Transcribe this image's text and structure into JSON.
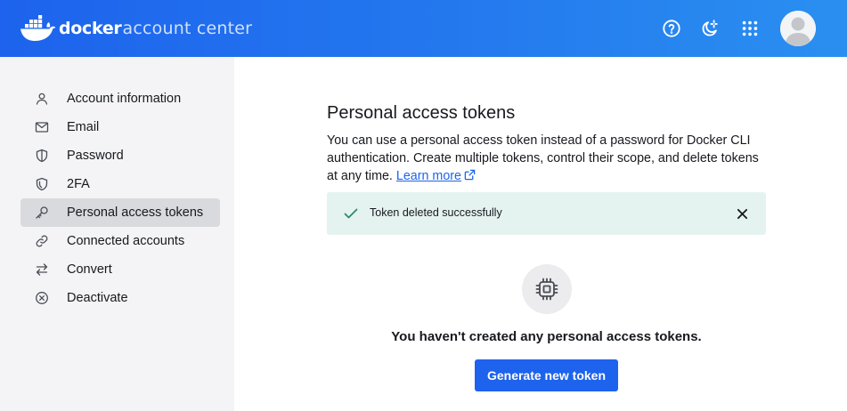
{
  "header": {
    "brand": "docker",
    "product": "account center",
    "icons": [
      "help-icon",
      "theme-icon",
      "apps-grid-icon"
    ],
    "colors": {
      "brand_blue": "#1d63ed",
      "gradient_end": "#2a8ff0"
    }
  },
  "sidebar": {
    "items": [
      {
        "label": "Account information",
        "icon": "user-icon",
        "active": false
      },
      {
        "label": "Email",
        "icon": "mail-icon",
        "active": false
      },
      {
        "label": "Password",
        "icon": "shield-icon",
        "active": false
      },
      {
        "label": "2FA",
        "icon": "shield-check-icon",
        "active": false
      },
      {
        "label": "Personal access tokens",
        "icon": "key-icon",
        "active": true
      },
      {
        "label": "Connected accounts",
        "icon": "link-icon",
        "active": false
      },
      {
        "label": "Convert",
        "icon": "swap-icon",
        "active": false
      },
      {
        "label": "Deactivate",
        "icon": "cancel-circle-icon",
        "active": false
      }
    ]
  },
  "main": {
    "title": "Personal access tokens",
    "description": "You can use a personal access token instead of a password for Docker CLI authentication. Create multiple tokens, control their scope, and delete tokens at any time.",
    "learn_more": "Learn more",
    "alert": {
      "text": "Token deleted successfully",
      "color": "#e5f3f0",
      "icon": "check-icon"
    },
    "empty_state": {
      "icon": "chip-icon",
      "text": "You haven't created any personal access tokens.",
      "button": "Generate new token"
    }
  }
}
